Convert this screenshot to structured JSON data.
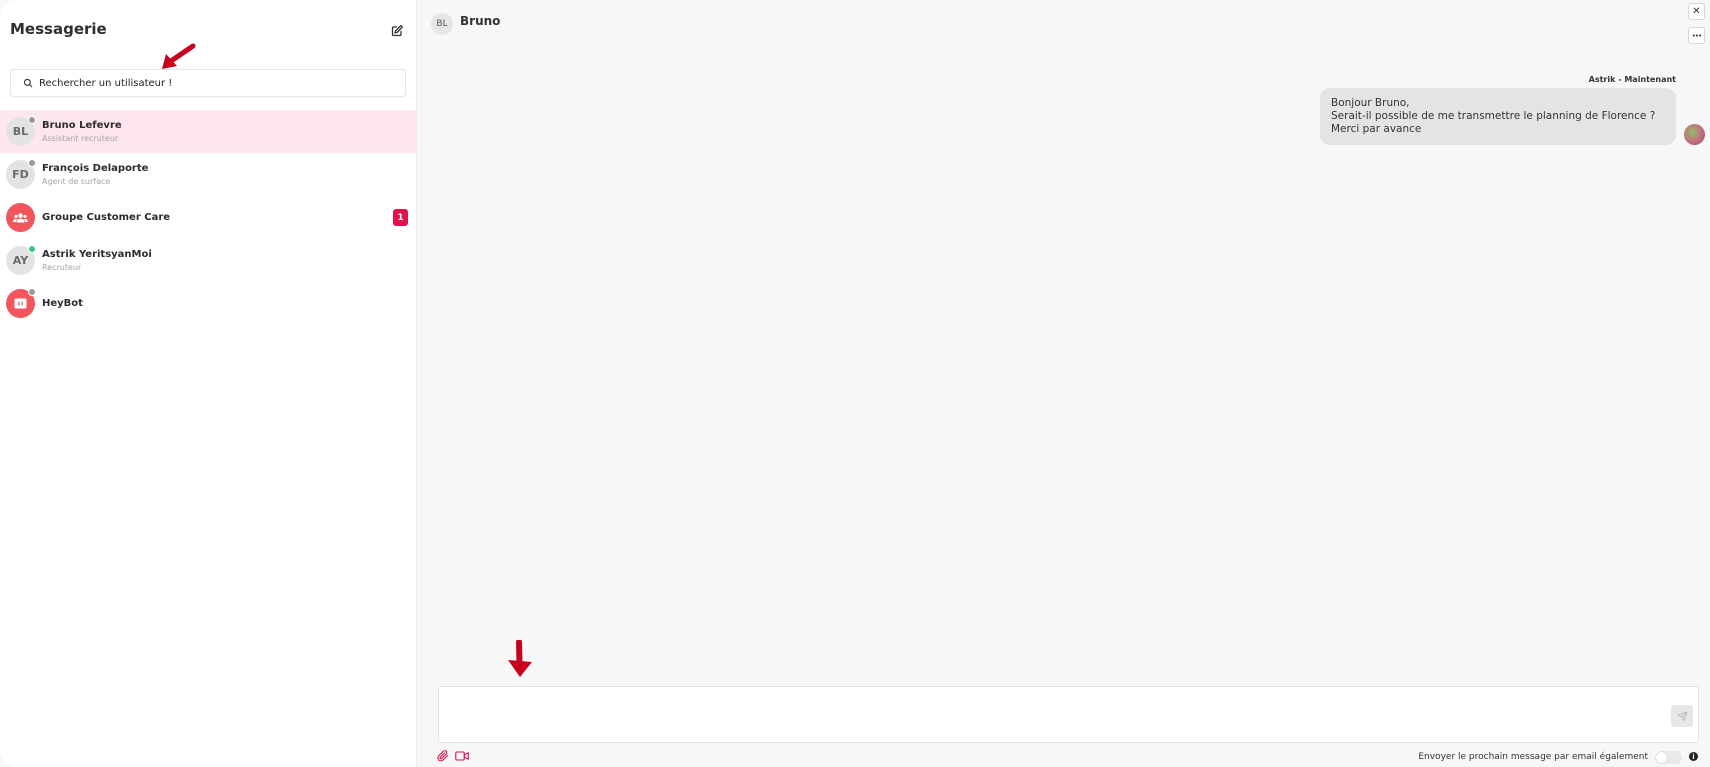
{
  "sidebar": {
    "title": "Messagerie",
    "compose_icon": "edit-icon",
    "search": {
      "placeholder": "Rechercher un utilisateur !",
      "value": ""
    },
    "contacts": [
      {
        "initials": "BL",
        "name": "Bruno Lefevre",
        "subtitle": "Assistant recruteur",
        "status": "offline",
        "active": true
      },
      {
        "initials": "FD",
        "name": "François Delaporte",
        "subtitle": "Agent de surface",
        "status": "offline"
      },
      {
        "icon": "group-icon",
        "name": "Groupe Customer Care",
        "badge": "1"
      },
      {
        "initials": "AY",
        "name": "Astrik YeritsyanMoi",
        "subtitle": "Recruteur",
        "status": "online"
      },
      {
        "icon": "bot-icon",
        "name": "HeyBot",
        "status": "offline"
      }
    ]
  },
  "chat": {
    "header": {
      "initials": "BL",
      "name": "Bruno"
    },
    "close_label": "✕",
    "more_label": "•••",
    "messages": [
      {
        "meta": "Astrik - Maintenant",
        "lines": [
          "Bonjour Bruno,",
          "Serait-il possible de me transmettre le planning de Florence ?",
          "Merci par avance"
        ]
      }
    ],
    "composer": {
      "value": "",
      "email_label": "Envoyer le prochain message par email également",
      "email_toggle_on": false,
      "info_label": "i"
    }
  },
  "colors": {
    "accent": "#e0114c",
    "active_row": "#fde6ec",
    "avatar_red": "#f0565c",
    "annotation_arrow": "#c8001e"
  }
}
